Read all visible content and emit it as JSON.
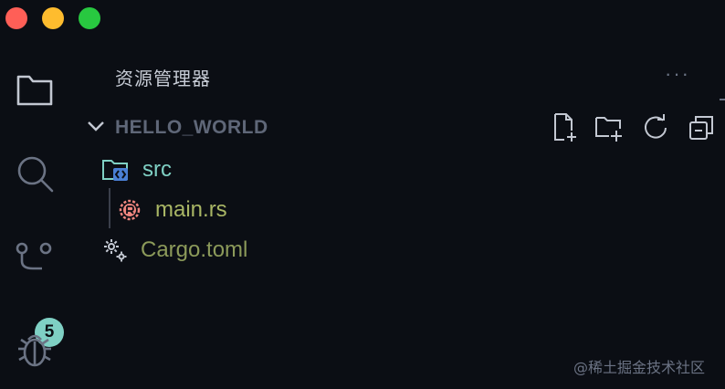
{
  "window": {
    "traffic_lights": {
      "close_color": "#ff5f57",
      "minimize_color": "#febc2e",
      "zoom_color": "#28c840"
    }
  },
  "activity_bar": {
    "items": [
      {
        "name": "explorer",
        "icon": "folder-icon"
      },
      {
        "name": "search",
        "icon": "search-icon"
      },
      {
        "name": "source-control",
        "icon": "source-control-icon",
        "badge": "5"
      },
      {
        "name": "debug",
        "icon": "bug-icon"
      }
    ]
  },
  "explorer": {
    "title": "资源管理器",
    "more_actions": "···",
    "section": {
      "title": "HELLO_WORLD",
      "actions": [
        "new-file-icon",
        "new-folder-icon",
        "refresh-icon",
        "collapse-all-icon"
      ]
    },
    "tree": [
      {
        "label": "src",
        "type": "folder",
        "icon": "src-folder-icon"
      },
      {
        "label": "main.rs",
        "type": "file",
        "icon": "rust-file-icon"
      },
      {
        "label": "Cargo.toml",
        "type": "file",
        "icon": "gear-icon"
      }
    ]
  },
  "colors": {
    "background": "#0b0e14",
    "folder_label": "#7fd0c4",
    "rust_file_label": "#a9b665",
    "toml_label": "#8c9a5a",
    "badge": "#7fd0c4",
    "rust_icon": "#f0867f"
  },
  "watermark": "@稀土掘金技术社区"
}
